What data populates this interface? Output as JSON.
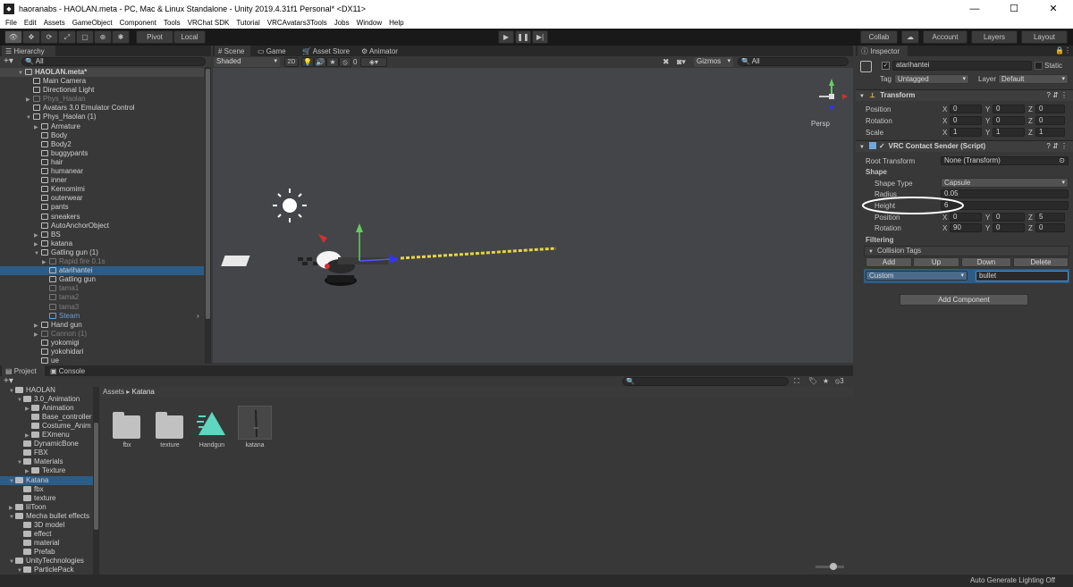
{
  "window": {
    "title": "haoranabs - HAOLAN.meta - PC, Mac & Linux Standalone - Unity 2019.4.31f1 Personal* <DX11>"
  },
  "menu": [
    "File",
    "Edit",
    "Assets",
    "GameObject",
    "Component",
    "Tools",
    "VRChat SDK",
    "Tutorial",
    "VRCAvatars3Tools",
    "Jobs",
    "Window",
    "Help"
  ],
  "toolbar": {
    "pivot": "Pivot",
    "local": "Local",
    "collab": "Collab",
    "account": "Account",
    "layers": "Layers",
    "layout": "Layout"
  },
  "hierarchy": {
    "tab": "Hierarchy",
    "search": "All",
    "scene": "HAOLAN.meta*",
    "items": [
      {
        "label": "Main Camera",
        "d": 1,
        "a": 0,
        "dim": 0
      },
      {
        "label": "Directional Light",
        "d": 1,
        "a": 0,
        "dim": 0
      },
      {
        "label": "Phys_Haolan",
        "d": 1,
        "a": 1,
        "dim": 1
      },
      {
        "label": "Avatars 3.0 Emulator Control",
        "d": 1,
        "a": 0,
        "dim": 0
      },
      {
        "label": "Phys_Haolan (1)",
        "d": 1,
        "a": 2,
        "dim": 0
      },
      {
        "label": "Armature",
        "d": 2,
        "a": 1,
        "dim": 0
      },
      {
        "label": "Body",
        "d": 2,
        "a": 0,
        "dim": 0
      },
      {
        "label": "Body2",
        "d": 2,
        "a": 0,
        "dim": 0
      },
      {
        "label": "buggypants",
        "d": 2,
        "a": 0,
        "dim": 0
      },
      {
        "label": "hair",
        "d": 2,
        "a": 0,
        "dim": 0
      },
      {
        "label": "humanear",
        "d": 2,
        "a": 0,
        "dim": 0
      },
      {
        "label": "inner",
        "d": 2,
        "a": 0,
        "dim": 0
      },
      {
        "label": "Kemomimi",
        "d": 2,
        "a": 0,
        "dim": 0
      },
      {
        "label": "outerwear",
        "d": 2,
        "a": 0,
        "dim": 0
      },
      {
        "label": "pants",
        "d": 2,
        "a": 0,
        "dim": 0
      },
      {
        "label": "sneakers",
        "d": 2,
        "a": 0,
        "dim": 0
      },
      {
        "label": "AutoAnchorObject",
        "d": 2,
        "a": 0,
        "dim": 0
      },
      {
        "label": "BS",
        "d": 2,
        "a": 1,
        "dim": 0
      },
      {
        "label": "katana",
        "d": 2,
        "a": 1,
        "dim": 0
      },
      {
        "label": "Gatling gun (1)",
        "d": 2,
        "a": 2,
        "dim": 0
      },
      {
        "label": "Rapid fire 0.1s",
        "d": 3,
        "a": 1,
        "dim": 1
      },
      {
        "label": "atarihantei",
        "d": 3,
        "a": 0,
        "dim": 0,
        "sel": 1
      },
      {
        "label": "Gatling gun",
        "d": 3,
        "a": 0,
        "dim": 0
      },
      {
        "label": "tama1",
        "d": 3,
        "a": 0,
        "dim": 1
      },
      {
        "label": "tama2",
        "d": 3,
        "a": 0,
        "dim": 1
      },
      {
        "label": "tama3",
        "d": 3,
        "a": 0,
        "dim": 1
      },
      {
        "label": "Steam",
        "d": 3,
        "a": 0,
        "dim": 1,
        "blue": 1
      },
      {
        "label": "Hand gun",
        "d": 2,
        "a": 1,
        "dim": 0
      },
      {
        "label": "Cannon (1)",
        "d": 2,
        "a": 1,
        "dim": 1
      },
      {
        "label": "yokomigi",
        "d": 2,
        "a": 0,
        "dim": 0
      },
      {
        "label": "yokohidari",
        "d": 2,
        "a": 0,
        "dim": 0
      },
      {
        "label": "ue",
        "d": 2,
        "a": 0,
        "dim": 0
      }
    ]
  },
  "scene": {
    "tabs": [
      "Scene",
      "Game",
      "Asset Store",
      "Animator"
    ],
    "shading": "Shaded",
    "mode2d": "2D",
    "hidden": "0",
    "gizmos": "Gizmos",
    "search": "All",
    "persp": "Persp"
  },
  "project": {
    "tabs": [
      "Project",
      "Console"
    ],
    "breadcrumb": [
      "Assets",
      "Katana"
    ],
    "hidden_count": "3",
    "tree": [
      {
        "label": "HAOLAN",
        "d": 0,
        "a": 2
      },
      {
        "label": "3.0_Animation",
        "d": 1,
        "a": 2
      },
      {
        "label": "Animation",
        "d": 2,
        "a": 1
      },
      {
        "label": "Base_controller",
        "d": 2,
        "a": 0
      },
      {
        "label": "Costume_Anim",
        "d": 2,
        "a": 0
      },
      {
        "label": "EXmenu",
        "d": 2,
        "a": 1
      },
      {
        "label": "DynamicBone",
        "d": 1,
        "a": 0
      },
      {
        "label": "FBX",
        "d": 1,
        "a": 0
      },
      {
        "label": "Materials",
        "d": 1,
        "a": 2
      },
      {
        "label": "Texture",
        "d": 2,
        "a": 1
      },
      {
        "label": "Katana",
        "d": 0,
        "a": 2,
        "sel": 1
      },
      {
        "label": "fbx",
        "d": 1,
        "a": 0
      },
      {
        "label": "texture",
        "d": 1,
        "a": 0
      },
      {
        "label": "lilToon",
        "d": 0,
        "a": 1
      },
      {
        "label": "Mecha bullet effects",
        "d": 0,
        "a": 2
      },
      {
        "label": "3D model",
        "d": 1,
        "a": 0
      },
      {
        "label": "effect",
        "d": 1,
        "a": 0
      },
      {
        "label": "material",
        "d": 1,
        "a": 0
      },
      {
        "label": "Prefab",
        "d": 1,
        "a": 0
      },
      {
        "label": "UnityTechnologies",
        "d": 0,
        "a": 2
      },
      {
        "label": "ParticlePack",
        "d": 1,
        "a": 2
      }
    ],
    "assets": [
      {
        "label": "fbx",
        "kind": "folder"
      },
      {
        "label": "texture",
        "kind": "folder"
      },
      {
        "label": "Handgun",
        "kind": "prefab"
      },
      {
        "label": "katana",
        "kind": "model"
      }
    ]
  },
  "inspector": {
    "tab": "Inspector",
    "object_name": "atarihantei",
    "static": "Static",
    "tag_label": "Tag",
    "tag": "Untagged",
    "layer_label": "Layer",
    "layer": "Default",
    "transform": {
      "title": "Transform",
      "rows": [
        {
          "label": "Position",
          "x": "0",
          "y": "0",
          "z": "0"
        },
        {
          "label": "Rotation",
          "x": "0",
          "y": "0",
          "z": "0"
        },
        {
          "label": "Scale",
          "x": "1",
          "y": "1",
          "z": "1"
        }
      ]
    },
    "contact": {
      "title": "VRC Contact Sender (Script)",
      "root_transform_label": "Root Transform",
      "root_transform": "None (Transform)",
      "shape_header": "Shape",
      "shape_type_label": "Shape Type",
      "shape_type": "Capsule",
      "radius_label": "Radius",
      "radius": "0.05",
      "height_label": "Height",
      "height": "6",
      "position": {
        "label": "Position",
        "x": "0",
        "y": "0",
        "z": "5"
      },
      "rotation": {
        "label": "Rotation",
        "x": "90",
        "y": "0",
        "z": "0"
      },
      "filtering": "Filtering",
      "collision_tags": "Collision Tags",
      "buttons": [
        "Add",
        "Up",
        "Down",
        "Delete"
      ],
      "tag_mode": "Custom",
      "tag_value": "bullet"
    },
    "add_component": "Add Component"
  },
  "status": {
    "text": "Auto Generate Lighting Off"
  }
}
